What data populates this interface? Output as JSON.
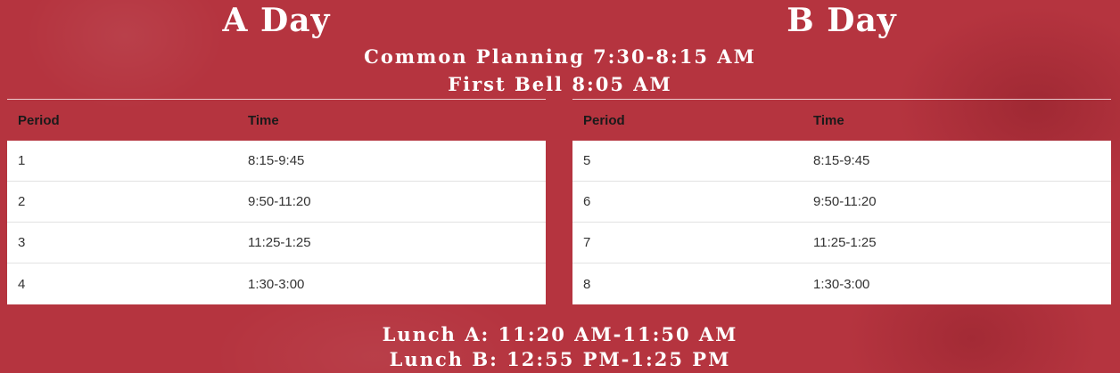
{
  "a_day": {
    "title": "A Day",
    "headers": {
      "period": "Period",
      "time": "Time"
    },
    "rows": [
      {
        "period": "1",
        "time": "8:15-9:45"
      },
      {
        "period": "2",
        "time": "9:50-11:20"
      },
      {
        "period": "3",
        "time": "11:25-1:25"
      },
      {
        "period": "4",
        "time": "1:30-3:00"
      }
    ]
  },
  "b_day": {
    "title": "B Day",
    "headers": {
      "period": "Period",
      "time": "Time"
    },
    "rows": [
      {
        "period": "5",
        "time": "8:15-9:45"
      },
      {
        "period": "6",
        "time": "9:50-11:20"
      },
      {
        "period": "7",
        "time": "11:25-1:25"
      },
      {
        "period": "8",
        "time": "1:30-3:00"
      }
    ]
  },
  "info": {
    "common_planning": "Common Planning 7:30-8:15 AM",
    "first_bell": "First Bell 8:05 AM"
  },
  "lunch": {
    "lunch_a": "Lunch A: 11:20 AM-11:50 AM",
    "lunch_b": "Lunch B: 12:55 PM-1:25 PM"
  },
  "colors": {
    "background": "#b5343f",
    "heading_text": "#ffffff",
    "table_body": "#ffffff"
  }
}
